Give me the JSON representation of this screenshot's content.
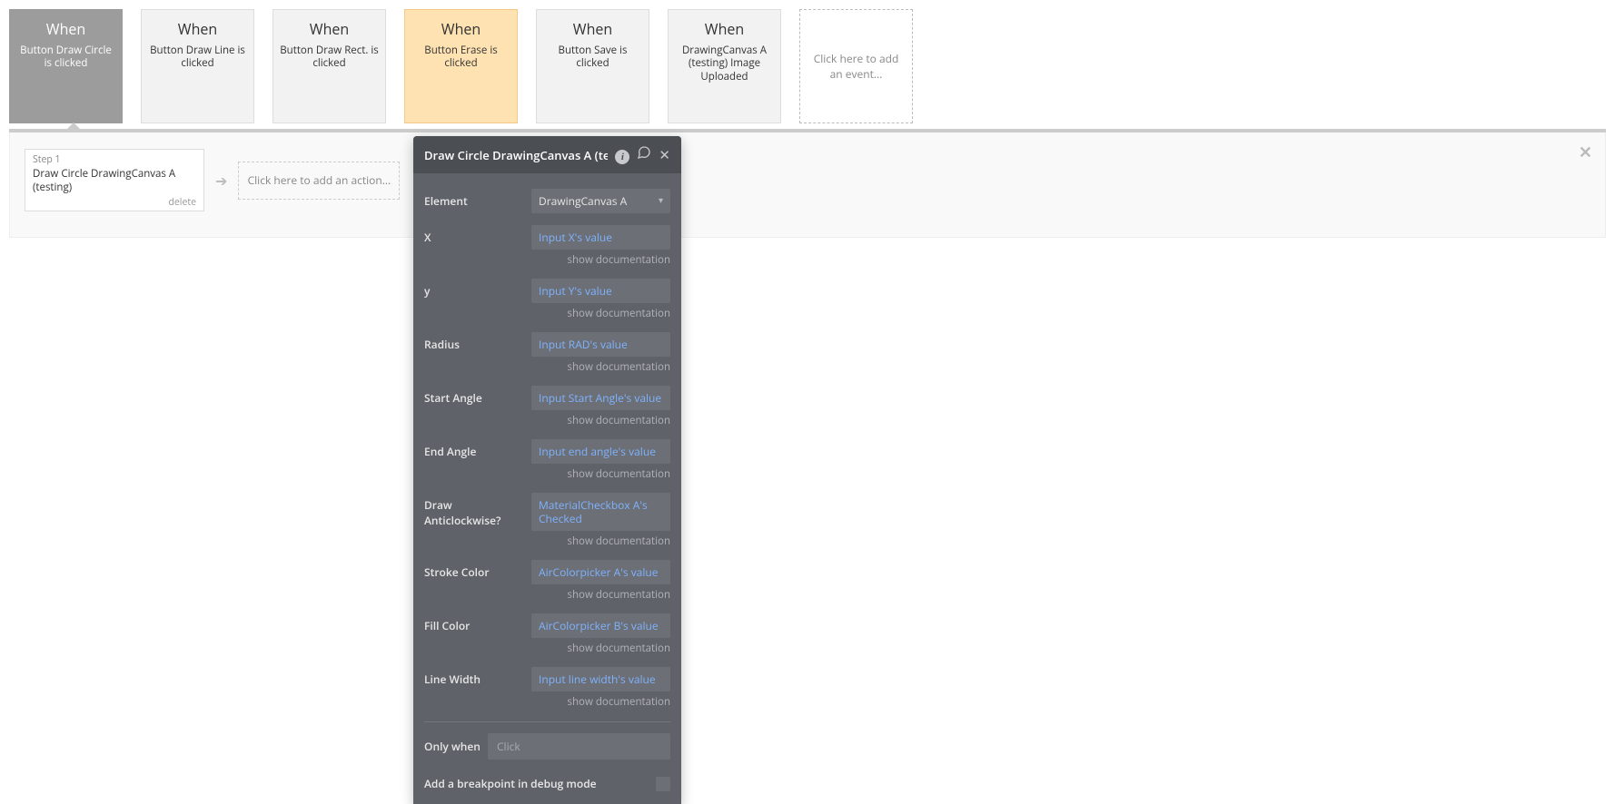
{
  "events": [
    {
      "when": "When",
      "desc": "Button Draw Circle is clicked",
      "state": "active"
    },
    {
      "when": "When",
      "desc": "Button Draw Line is clicked",
      "state": "normal"
    },
    {
      "when": "When",
      "desc": "Button Draw Rect. is clicked",
      "state": "normal"
    },
    {
      "when": "When",
      "desc": "Button Erase is clicked",
      "state": "highlighted"
    },
    {
      "when": "When",
      "desc": "Button Save is clicked",
      "state": "normal"
    },
    {
      "when": "When",
      "desc": "DrawingCanvas A (testing) Image Uploaded",
      "state": "normal"
    }
  ],
  "add_event_text": "Click here to add an event...",
  "step": {
    "label": "Step 1",
    "title": "Draw Circle DrawingCanvas A (testing)",
    "delete": "delete"
  },
  "add_action_text": "Click here to add an action...",
  "panel": {
    "title": "Draw Circle DrawingCanvas A (te",
    "element_label": "Element",
    "element_value": "DrawingCanvas A",
    "fields": [
      {
        "label": "X",
        "value": "Input X's value"
      },
      {
        "label": "y",
        "value": "Input Y's value"
      },
      {
        "label": "Radius",
        "value": "Input RAD's value"
      },
      {
        "label": "Start Angle",
        "value": "Input Start Angle's value"
      },
      {
        "label": "End Angle",
        "value": "Input end angle's value"
      },
      {
        "label": "Draw Anticlockwise?",
        "value": "MaterialCheckbox A's Checked"
      },
      {
        "label": "Stroke Color",
        "value": "AirColorpicker A's value"
      },
      {
        "label": "Fill Color",
        "value": "AirColorpicker B's value"
      },
      {
        "label": "Line Width",
        "value": "Input line width's value"
      }
    ],
    "show_doc": "show documentation",
    "only_when_label": "Only when",
    "only_when_value": "Click",
    "breakpoint_label": "Add a breakpoint in debug mode"
  }
}
